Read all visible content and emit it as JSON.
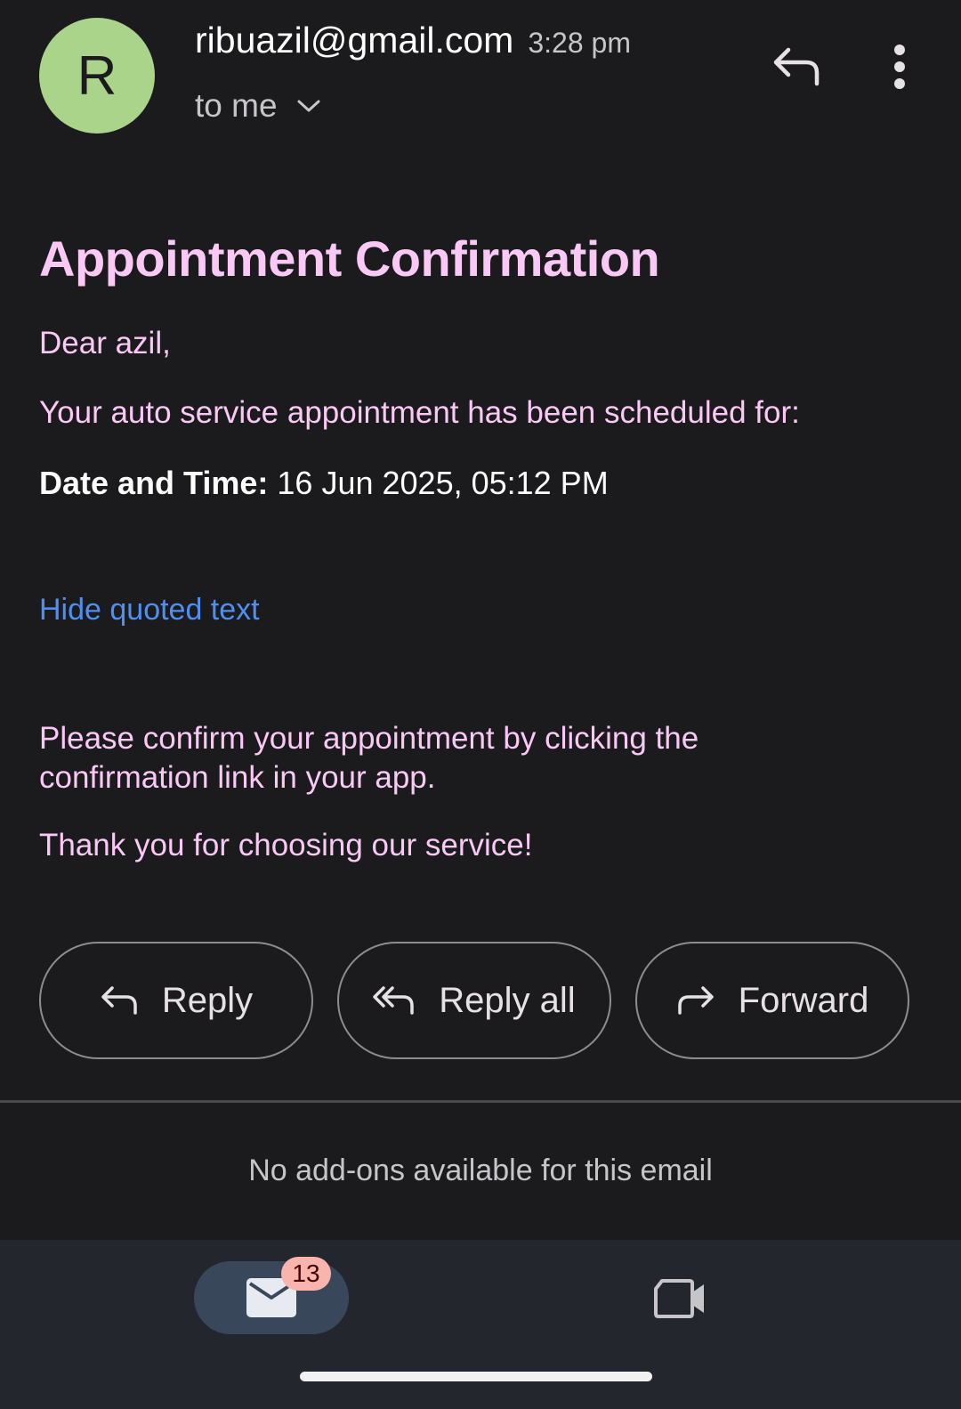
{
  "header": {
    "avatar_letter": "R",
    "sender": "ribuazil@gmail.com",
    "time": "3:28 pm",
    "recipient": "to me",
    "icons": {
      "reply": "reply-icon",
      "more": "more-vertical-icon",
      "expand": "chevron-down-icon"
    },
    "avatar_color": "#aad48a"
  },
  "email": {
    "title": "Appointment Confirmation",
    "greeting": "Dear azil,",
    "intro": "Your auto service appointment has been scheduled for:",
    "datetime_label": "Date and Time:",
    "datetime_value": " 16 Jun 2025, 05:12 PM",
    "hide_quoted": "Hide quoted text",
    "confirm_text": "Please confirm your appointment by clicking the confirmation link in your app.",
    "thanks": "Thank you for choosing our service!",
    "text_color": "#f9c8f5",
    "link_color": "#4f8ff2"
  },
  "actions": {
    "reply": "Reply",
    "reply_all": "Reply all",
    "forward": "Forward"
  },
  "footer": {
    "no_addons": "No add-ons available for this email"
  },
  "bottom_nav": {
    "mail_badge": "13",
    "items": [
      "mail-icon",
      "video-call-icon"
    ]
  }
}
